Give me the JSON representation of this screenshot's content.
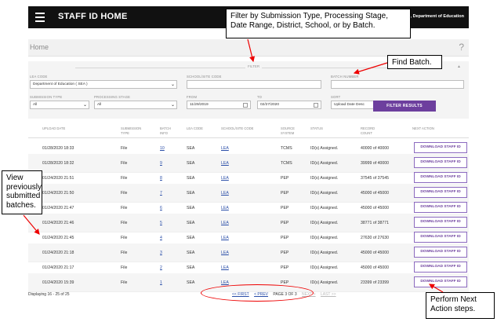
{
  "app": {
    "title": "STAFF ID HOME",
    "user": "joy .Sohbrigh, Department of Education"
  },
  "breadcrumb": {
    "home": "Home",
    "help": "?"
  },
  "filter": {
    "legend": "FILTER",
    "collapse": "▲",
    "lea_code": {
      "label": "LEA CODE",
      "value": "Department of Education ( SEA )"
    },
    "school_site_code": {
      "label": "SCHOOL/SITE CODE",
      "value": ""
    },
    "batch_number": {
      "label": "BATCH NUMBER",
      "value": ""
    },
    "submission_type": {
      "label": "SUBMISSION TYPE",
      "value": "All"
    },
    "processing_stage": {
      "label": "PROCESSING STAGE",
      "value": "All"
    },
    "from": {
      "label": "FROM",
      "value": "11/29/2019"
    },
    "to": {
      "label": "TO",
      "value": "02/27/2020"
    },
    "sort": {
      "label": "SORT",
      "value": "Upload Date Desc"
    },
    "button": "FILTER RESULTS"
  },
  "table": {
    "headers": [
      "UPLOAD DATE",
      "SUBMISSION TYPE",
      "BATCH INFO",
      "LEA CODE",
      "SCHOOL/SITE CODE",
      "SOURCE SYSTEM",
      "STATUS",
      "RECORD COUNT",
      "NEXT ACTION"
    ],
    "rows": [
      {
        "date": "01/28/2020 18:33",
        "type": "File",
        "batch": "10",
        "lea": "SEA",
        "school": "LEA",
        "source": "TCMS",
        "status": "ID(s) Assigned.",
        "count": "40000 of 40000",
        "action": "DOWNLOAD STAFF ID"
      },
      {
        "date": "01/28/2020 18:32",
        "type": "File",
        "batch": "9",
        "lea": "SEA",
        "school": "LEA",
        "source": "TCMS",
        "status": "ID(s) Assigned.",
        "count": "39999 of 40000",
        "action": "DOWNLOAD STAFF ID"
      },
      {
        "date": "01/24/2020 21:51",
        "type": "File",
        "batch": "8",
        "lea": "SEA",
        "school": "LEA",
        "source": "PEP",
        "status": "ID(s) Assigned.",
        "count": "37545 of 37545",
        "action": "DOWNLOAD STAFF ID"
      },
      {
        "date": "01/24/2020 21:50",
        "type": "File",
        "batch": "7",
        "lea": "SEA",
        "school": "LEA",
        "source": "PEP",
        "status": "ID(s) Assigned.",
        "count": "45000 of 45000",
        "action": "DOWNLOAD STAFF ID"
      },
      {
        "date": "01/24/2020 21:47",
        "type": "File",
        "batch": "6",
        "lea": "SEA",
        "school": "LEA",
        "source": "PEP",
        "status": "ID(s) Assigned.",
        "count": "45000 of 45000",
        "action": "DOWNLOAD STAFF ID"
      },
      {
        "date": "01/24/2020 21:46",
        "type": "File",
        "batch": "5",
        "lea": "SEA",
        "school": "LEA",
        "source": "PEP",
        "status": "ID(s) Assigned.",
        "count": "38771 of 38771",
        "action": "DOWNLOAD STAFF ID"
      },
      {
        "date": "01/24/2020 21:45",
        "type": "File",
        "batch": "4",
        "lea": "SEA",
        "school": "LEA",
        "source": "PEP",
        "status": "ID(s) Assigned.",
        "count": "27630 of 27630",
        "action": "DOWNLOAD STAFF ID"
      },
      {
        "date": "01/24/2020 21:18",
        "type": "File",
        "batch": "3",
        "lea": "SEA",
        "school": "LEA",
        "source": "PEP",
        "status": "ID(s) Assigned.",
        "count": "45000 of 45000",
        "action": "DOWNLOAD STAFF ID"
      },
      {
        "date": "01/24/2020 21:17",
        "type": "File",
        "batch": "2",
        "lea": "SEA",
        "school": "LEA",
        "source": "PEP",
        "status": "ID(s) Assigned.",
        "count": "45000 of 45000",
        "action": "DOWNLOAD STAFF ID"
      },
      {
        "date": "01/24/2020 15:39",
        "type": "File",
        "batch": "1",
        "lea": "SEA",
        "school": "LEA",
        "source": "PEP",
        "status": "ID(s) Assigned.",
        "count": "23399 of 23399",
        "action": "DOWNLOAD STAFF ID"
      }
    ]
  },
  "footer": {
    "displaying": "Displaying 16 - 25 of 25",
    "pager": {
      "first": "<< FIRST",
      "prev": "< PREV",
      "page": "PAGE 3 OF 3",
      "next": "NEXT >",
      "last": "LAST >>"
    }
  },
  "callouts": {
    "filter": "Filter by Submission Type, Processing Stage, Date Range, District, School, or by Batch.",
    "find_batch": "Find Batch.",
    "view_batches": "View previously submitted batches.",
    "next_action": "Perform Next Action steps."
  },
  "colors": {
    "accent": "#6d3f9e",
    "topbar": "#111111",
    "link": "#2a4ea8",
    "annotation": "#ee0000"
  }
}
